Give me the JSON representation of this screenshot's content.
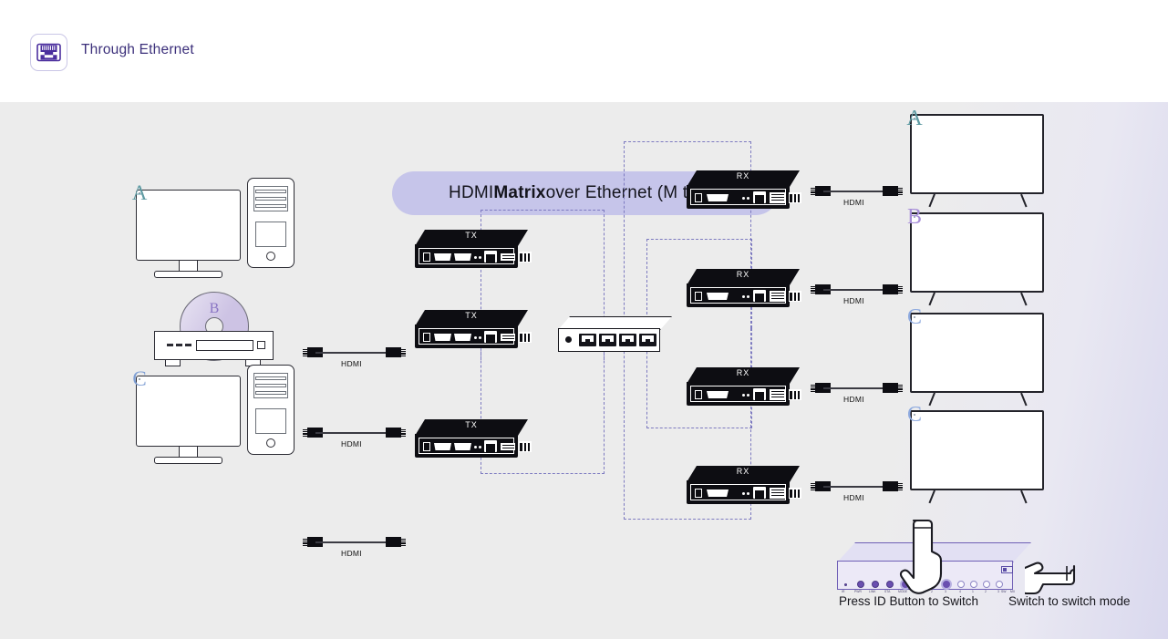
{
  "header": {
    "icon": "ethernet-port-icon",
    "title": "Through Ethernet"
  },
  "diagram": {
    "title_prefix": "HDMI ",
    "title_bold": "Matrix",
    "title_suffix": " over Ethernet (M to N)",
    "title_full": "HDMI Matrix over Ethernet (M to N)"
  },
  "sources": [
    {
      "name": "pc-a",
      "type": "computer",
      "screen_letter": "A",
      "screen_color": "#cde3e4",
      "letter_color": "#5f9ba3",
      "cable_label": "HDMI",
      "device_label": "TX"
    },
    {
      "name": "dvd-b",
      "type": "dvd-player",
      "screen_letter": "B",
      "screen_color": "#cdc3e4",
      "letter_color": "#8a76c4",
      "cable_label": "HDMI",
      "device_label": "TX"
    },
    {
      "name": "pc-c",
      "type": "computer",
      "screen_letter": "C",
      "screen_color": "#d5e1f3",
      "letter_color": "#7f9fd4",
      "cable_label": "HDMI",
      "device_label": "TX"
    }
  ],
  "displays": [
    {
      "name": "tv-1",
      "screen_letter": "A",
      "screen_color": "#cde3e4",
      "letter_color": "#5f9ba3",
      "cable_label": "HDMI",
      "device_label": "RX"
    },
    {
      "name": "tv-2",
      "screen_letter": "B",
      "screen_color": "#ddd2ec",
      "letter_color": "#a78ed8",
      "cable_label": "HDMI",
      "device_label": "RX"
    },
    {
      "name": "tv-3",
      "screen_letter": "C",
      "screen_color": "#dbe5f5",
      "letter_color": "#8eaadf",
      "cable_label": "HDMI",
      "device_label": "RX"
    },
    {
      "name": "tv-4",
      "screen_letter": "C",
      "screen_color": "#dbe5f5",
      "letter_color": "#8eaadf",
      "cable_label": "HDMI",
      "device_label": "RX"
    }
  ],
  "network_switch": {
    "name": "ethernet-switch",
    "port_count": 4
  },
  "controller": {
    "name": "id-control-panel",
    "led_labels": [
      "IR",
      "PWR",
      "LINK",
      "STA",
      "MODE",
      "1",
      "2",
      "3",
      "4",
      "1",
      "2",
      "3",
      "4",
      "5"
    ],
    "mode_labels": [
      "SW",
      "MX"
    ],
    "caption_left": "Press ID Button to Switch",
    "caption_right": "Switch to switch mode"
  },
  "colors": {
    "accent_purple": "#6a4fb0",
    "title_pill_bg": "#c6c5ea",
    "panel_bg": "#ececec",
    "device_black": "#0d0d12",
    "dashed_line": "#7d7ac0"
  }
}
